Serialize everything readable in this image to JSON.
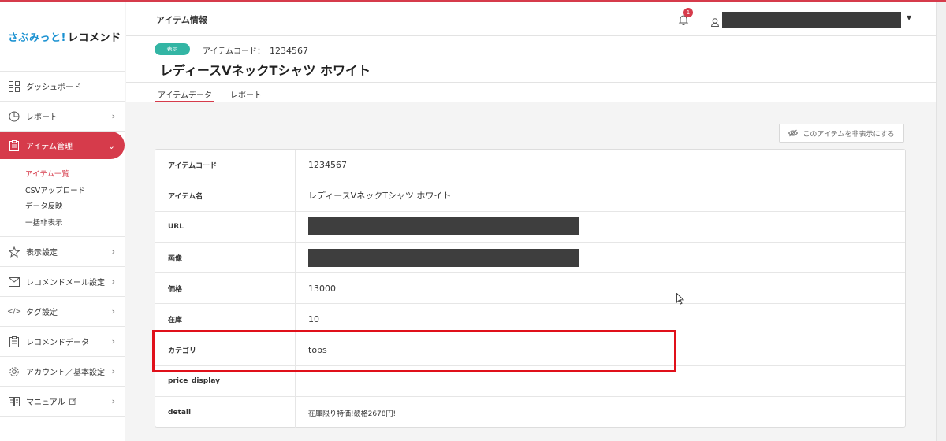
{
  "brand": {
    "part1": "さぶみっと!",
    "part2": "レコメンド"
  },
  "sidebar": {
    "items": [
      {
        "label": "ダッシュボード",
        "icon": "dashboard-icon"
      },
      {
        "label": "レポート",
        "icon": "pie-chart-icon"
      },
      {
        "label": "アイテム管理",
        "icon": "clipboard-icon"
      },
      {
        "label": "表示設定",
        "icon": "star-icon"
      },
      {
        "label": "レコメンドメール設定",
        "icon": "mail-icon"
      },
      {
        "label": "タグ設定",
        "icon": "code-icon"
      },
      {
        "label": "レコメンドデータ",
        "icon": "document-icon"
      },
      {
        "label": "アカウント／基本設定",
        "icon": "gear-icon"
      },
      {
        "label": "マニュアル",
        "icon": "book-icon"
      }
    ],
    "subitems": [
      "アイテム一覧",
      "CSVアップロード",
      "データ反映",
      "一括非表示"
    ]
  },
  "header": {
    "title": "アイテム情報",
    "notification_count": "1"
  },
  "item_header": {
    "status": "表示",
    "code_label": "アイテムコード：",
    "code_value": "1234567",
    "title": "レディースVネックTシャツ ホワイト"
  },
  "tabs": [
    "アイテムデータ",
    "レポート"
  ],
  "hide_button": "このアイテムを非表示にする",
  "table": [
    {
      "key": "アイテムコード",
      "value": "1234567"
    },
    {
      "key": "アイテム名",
      "value": "レディースVネックTシャツ ホワイト"
    },
    {
      "key": "URL",
      "value": ""
    },
    {
      "key": "画像",
      "value": ""
    },
    {
      "key": "価格",
      "value": "13000"
    },
    {
      "key": "在庫",
      "value": "10"
    },
    {
      "key": "カテゴリ",
      "value": "tops"
    },
    {
      "key": "price_display",
      "value": ""
    },
    {
      "key": "detail",
      "value": "在庫限り特価!破格2678円!"
    }
  ],
  "colors": {
    "accent": "#d63b4b",
    "brand_blue": "#1a91d1",
    "status_green": "#33b5a4",
    "highlight_red": "#e0101a"
  }
}
